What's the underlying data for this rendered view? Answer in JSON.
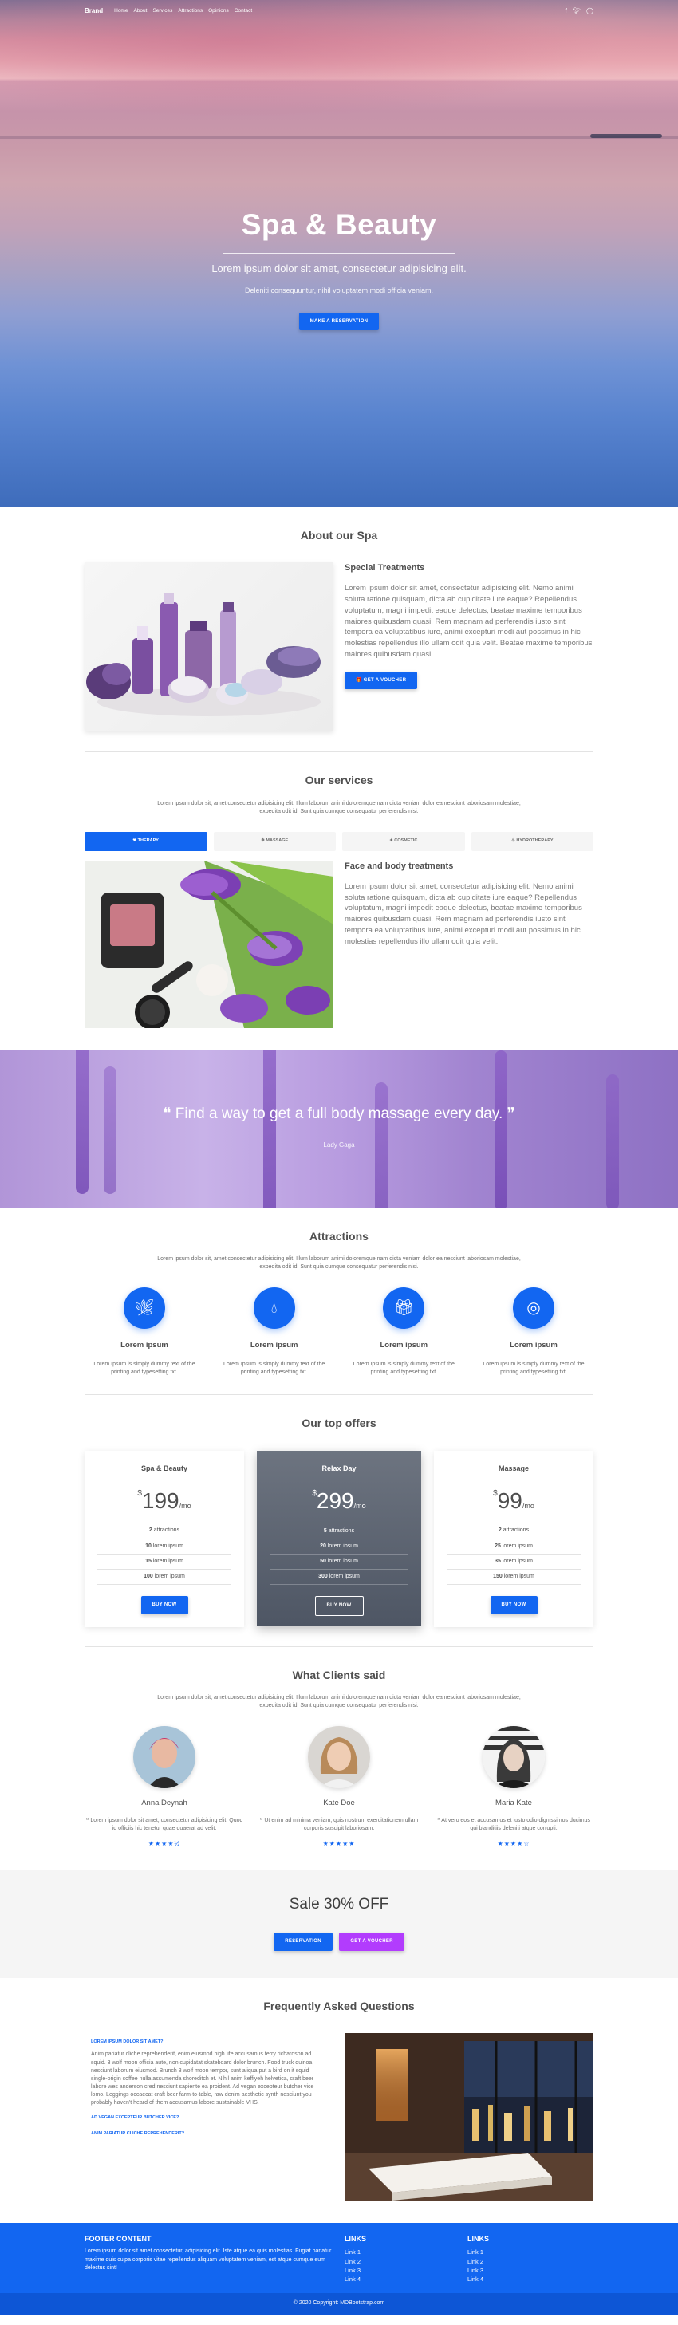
{
  "navbar": {
    "brand": "Brand",
    "links": [
      "Home",
      "About",
      "Services",
      "Attractions",
      "Opinions",
      "Contact"
    ],
    "icons": [
      "facebook-icon",
      "twitter-icon",
      "instagram-icon"
    ]
  },
  "hero": {
    "title": "Spa & Beauty",
    "subtitle": "Lorem ipsum dolor sit amet, consectetur adipisicing elit.",
    "small": "Deleniti consequuntur, nihil voluptatem modi officia veniam.",
    "button": "Make a reservation"
  },
  "about": {
    "title": "About our Spa",
    "heading": "Special Treatments",
    "text": "Lorem ipsum dolor sit amet, consectetur adipisicing elit. Nemo animi soluta ratione quisquam, dicta ab cupiditate iure eaque? Repellendus voluptatum, magni impedit eaque delectus, beatae maxime temporibus maiores quibusdam quasi. Rem magnam ad perferendis iusto sint tempora ea voluptatibus iure, animi excepturi modi aut possimus in hic molestias repellendus illo ullam odit quia velit. Beatae maxime temporibus maiores quibusdam quasi.",
    "button": "Get a voucher"
  },
  "services": {
    "title": "Our services",
    "lead": "Lorem ipsum dolor sit, amet consectetur adipisicing elit. Illum laborum animi doloremque nam dicta veniam dolor ea nesciunt laboriosam molestiae, expedita odit id! Sunt quia cumque consequatur perferendis nisi.",
    "tabs": [
      "Therapy",
      "Massage",
      "Cosmetic",
      "Hydrotherapy"
    ],
    "heading": "Face and body treatments",
    "text": "Lorem ipsum dolor sit amet, consectetur adipisicing elit. Nemo animi soluta ratione quisquam, dicta ab cupiditate iure eaque? Repellendus voluptatum, magni impedit eaque delectus, beatae maxime temporibus maiores quibusdam quasi. Rem magnam ad perferendis iusto sint tempora ea voluptatibus iure, animi excepturi modi aut possimus in hic molestias repellendus illo ullam odit quia velit."
  },
  "quote": {
    "text": "Find a way to get a full body massage every day.",
    "author": "Lady Gaga"
  },
  "attractions": {
    "title": "Attractions",
    "lead": "Lorem ipsum dolor sit, amet consectetur adipisicing elit. Illum laborum animi doloremque nam dicta veniam dolor ea nesciunt laboriosam molestiae, expedita odit id! Sunt quia cumque consequatur perferendis nisi.",
    "items": [
      {
        "icon": "leaf-icon",
        "title": "Lorem ipsum",
        "text": "Lorem Ipsum is simply dummy text of the printing and typesetting txt."
      },
      {
        "icon": "water-drop-icon",
        "title": "Lorem ipsum",
        "text": "Lorem Ipsum is simply dummy text of the printing and typesetting txt."
      },
      {
        "icon": "gift-icon",
        "title": "Lorem ipsum",
        "text": "Lorem Ipsum is simply dummy text of the printing and typesetting txt."
      },
      {
        "icon": "bullseye-icon",
        "title": "Lorem ipsum",
        "text": "Lorem Ipsum is simply dummy text of the printing and typesetting txt."
      }
    ]
  },
  "offers": {
    "title": "Our top offers",
    "cards": [
      {
        "name": "Spa & Beauty",
        "price": "199",
        "period": "/mo",
        "rows": [
          [
            "2",
            "attractions"
          ],
          [
            "10",
            "lorem ipsum"
          ],
          [
            "15",
            "lorem ipsum"
          ],
          [
            "100",
            "lorem ipsum"
          ]
        ],
        "button": "Buy now"
      },
      {
        "name": "Relax Day",
        "price": "299",
        "period": "/mo",
        "rows": [
          [
            "5",
            "attractions"
          ],
          [
            "20",
            "lorem ipsum"
          ],
          [
            "50",
            "lorem ipsum"
          ],
          [
            "300",
            "lorem ipsum"
          ]
        ],
        "button": "Buy now"
      },
      {
        "name": "Massage",
        "price": "99",
        "period": "/mo",
        "rows": [
          [
            "2",
            "attractions"
          ],
          [
            "25",
            "lorem ipsum"
          ],
          [
            "35",
            "lorem ipsum"
          ],
          [
            "150",
            "lorem ipsum"
          ]
        ],
        "button": "Buy now"
      }
    ],
    "currency": "$"
  },
  "clients": {
    "title": "What Clients said",
    "lead": "Lorem ipsum dolor sit, amet consectetur adipisicing elit. Illum laborum animi doloremque nam dicta veniam dolor ea nesciunt laboriosam molestiae, expedita odit id! Sunt quia cumque consequatur perferendis nisi.",
    "items": [
      {
        "name": "Anna Deynah",
        "text": "Lorem ipsum dolor sit amet, consectetur adipisicing elit. Quod id officiis hic tenetur quae quaerat ad velit.",
        "stars": "★★★★½"
      },
      {
        "name": "Kate Doe",
        "text": "Ut enim ad minima veniam, quis nostrum exercitationem ullam corporis suscipit laboriosam.",
        "stars": "★★★★★"
      },
      {
        "name": "Maria Kate",
        "text": "At vero eos et accusamus et iusto odio dignissimos ducimus qui blanditiis deleniti atque corrupti.",
        "stars": "★★★★☆"
      }
    ]
  },
  "sale": {
    "title": "Sale 30% OFF",
    "btn1": "Reservation",
    "btn2": "Get a voucher"
  },
  "faq": {
    "title": "Frequently Asked Questions",
    "q1": "Lorem ipsum dolor sit amet?",
    "a1": "Anim pariatur cliche reprehenderit, enim eiusmod high life accusamus terry richardson ad squid. 3 wolf moon officia aute, non cupidatat skateboard dolor brunch. Food truck quinoa nesciunt laborum eiusmod. Brunch 3 wolf moon tempor, sunt aliqua put a bird on it squid single-origin coffee nulla assumenda shoreditch et. Nihil anim keffiyeh helvetica, craft beer labore wes anderson cred nesciunt sapiente ea proident. Ad vegan excepteur butcher vice lomo. Leggings occaecat craft beer farm-to-table, raw denim aesthetic synth nesciunt you probably haven't heard of them accusamus labore sustainable VHS.",
    "q2": "Ad vegan excepteur butcher vice?",
    "q3": "Anim pariatur cliche reprehenderit?"
  },
  "footer": {
    "content_title": "FOOTER CONTENT",
    "content_text": "Lorem ipsum dolor sit amet consectetur, adipisicing elit. Iste atque ea quis molestias. Fugiat pariatur maxime quis culpa corporis vitae repellendus aliquam voluptatem veniam, est atque cumque eum delectus sint!",
    "links1_title": "LINKS",
    "links1": [
      "Link 1",
      "Link 2",
      "Link 3",
      "Link 4"
    ],
    "links2_title": "LINKS",
    "links2": [
      "Link 1",
      "Link 2",
      "Link 3",
      "Link 4"
    ],
    "copyright": "© 2020 Copyright: MDBootstrap.com"
  },
  "colors": {
    "primary": "#1266f1",
    "secondary": "#b23cfd"
  }
}
